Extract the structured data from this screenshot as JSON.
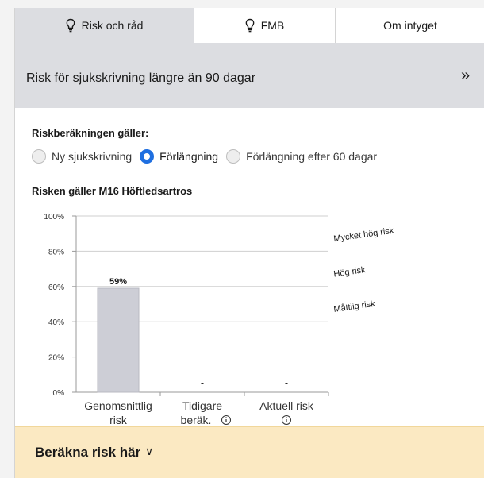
{
  "tabs": [
    {
      "label": "Risk och råd",
      "icon": "lightbulb-icon",
      "active": true
    },
    {
      "label": "FMB",
      "icon": "lightbulb-icon",
      "active": false
    },
    {
      "label": "Om intyget",
      "icon": "",
      "active": false
    }
  ],
  "header": {
    "title": "Risk för sjukskrivning längre än 90 dagar",
    "collapse_glyph": "»"
  },
  "calc": {
    "label": "Riskberäkningen gäller:",
    "options": [
      {
        "label": "Ny sjukskrivning",
        "selected": false
      },
      {
        "label": "Förlängning",
        "selected": true
      },
      {
        "label": "Förlängning efter 60 dagar",
        "selected": false
      }
    ]
  },
  "risk_label": "Risken gäller M16 Höftledsartros",
  "chart_data": {
    "type": "bar",
    "categories": [
      [
        "Genomsnittlig",
        "risk"
      ],
      [
        "Tidigare",
        "beräk."
      ],
      [
        "Aktuell risk",
        ""
      ]
    ],
    "category_info_icon": [
      false,
      true,
      true
    ],
    "values": [
      59,
      null,
      null
    ],
    "data_labels": [
      "59%",
      "-",
      "-"
    ],
    "ylim": [
      0,
      100
    ],
    "yticks": [
      0,
      20,
      40,
      60,
      80,
      100
    ],
    "ytick_labels": [
      "0%",
      "20%",
      "40%",
      "60%",
      "80%",
      "100%"
    ],
    "thresholds": [
      80,
      60,
      40
    ],
    "zone_labels": [
      {
        "label": "Mycket hög risk",
        "y": 90
      },
      {
        "label": "Hög risk",
        "y": 70
      },
      {
        "label": "Måttlig risk",
        "y": 50
      }
    ],
    "bar_color": "#cdced6",
    "grid": false
  },
  "accordion": {
    "title": "Beräkna risk här",
    "chevron": "∨"
  },
  "colors": {
    "accent": "#1f6fe0",
    "band": "#dcdde1",
    "accordion": "#fbe9c2"
  }
}
